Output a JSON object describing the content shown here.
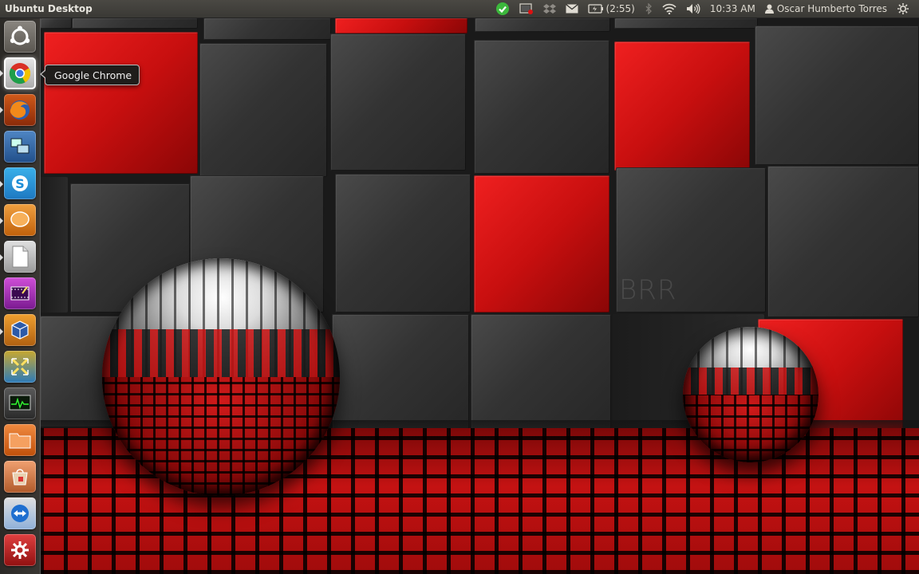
{
  "panel": {
    "title": "Ubuntu Desktop",
    "battery": "(2:55)",
    "time": "10:33 AM",
    "user": "Oscar Humberto Torres"
  },
  "indicators": [
    {
      "name": "update-check-icon",
      "color": "#3cb83c"
    },
    {
      "name": "screen-recorder-icon"
    },
    {
      "name": "dropbox-icon"
    },
    {
      "name": "mail-icon"
    },
    {
      "name": "battery-icon"
    },
    {
      "name": "bluetooth-icon"
    },
    {
      "name": "wifi-icon"
    },
    {
      "name": "volume-icon"
    },
    {
      "name": "user-icon"
    },
    {
      "name": "session-gear-icon"
    }
  ],
  "launcher": {
    "items": [
      {
        "name": "dash-home-icon"
      },
      {
        "name": "google-chrome-icon",
        "running": true
      },
      {
        "name": "firefox-icon",
        "running": true
      },
      {
        "name": "remote-desktop-icon"
      },
      {
        "name": "skype-icon",
        "running": true
      },
      {
        "name": "pidgin-icon",
        "running": true
      },
      {
        "name": "libreoffice-icon",
        "running": true
      },
      {
        "name": "video-editor-icon"
      },
      {
        "name": "virtualbox-icon",
        "running": true
      },
      {
        "name": "workspace-switcher-icon"
      },
      {
        "name": "system-monitor-icon"
      },
      {
        "name": "files-icon"
      },
      {
        "name": "software-center-icon"
      },
      {
        "name": "teamviewer-icon"
      },
      {
        "name": "system-settings-icon"
      }
    ]
  },
  "tooltip": {
    "label": "Google Chrome"
  },
  "wallpaper": {
    "watermark": "BRR",
    "accent": "#d01010"
  }
}
